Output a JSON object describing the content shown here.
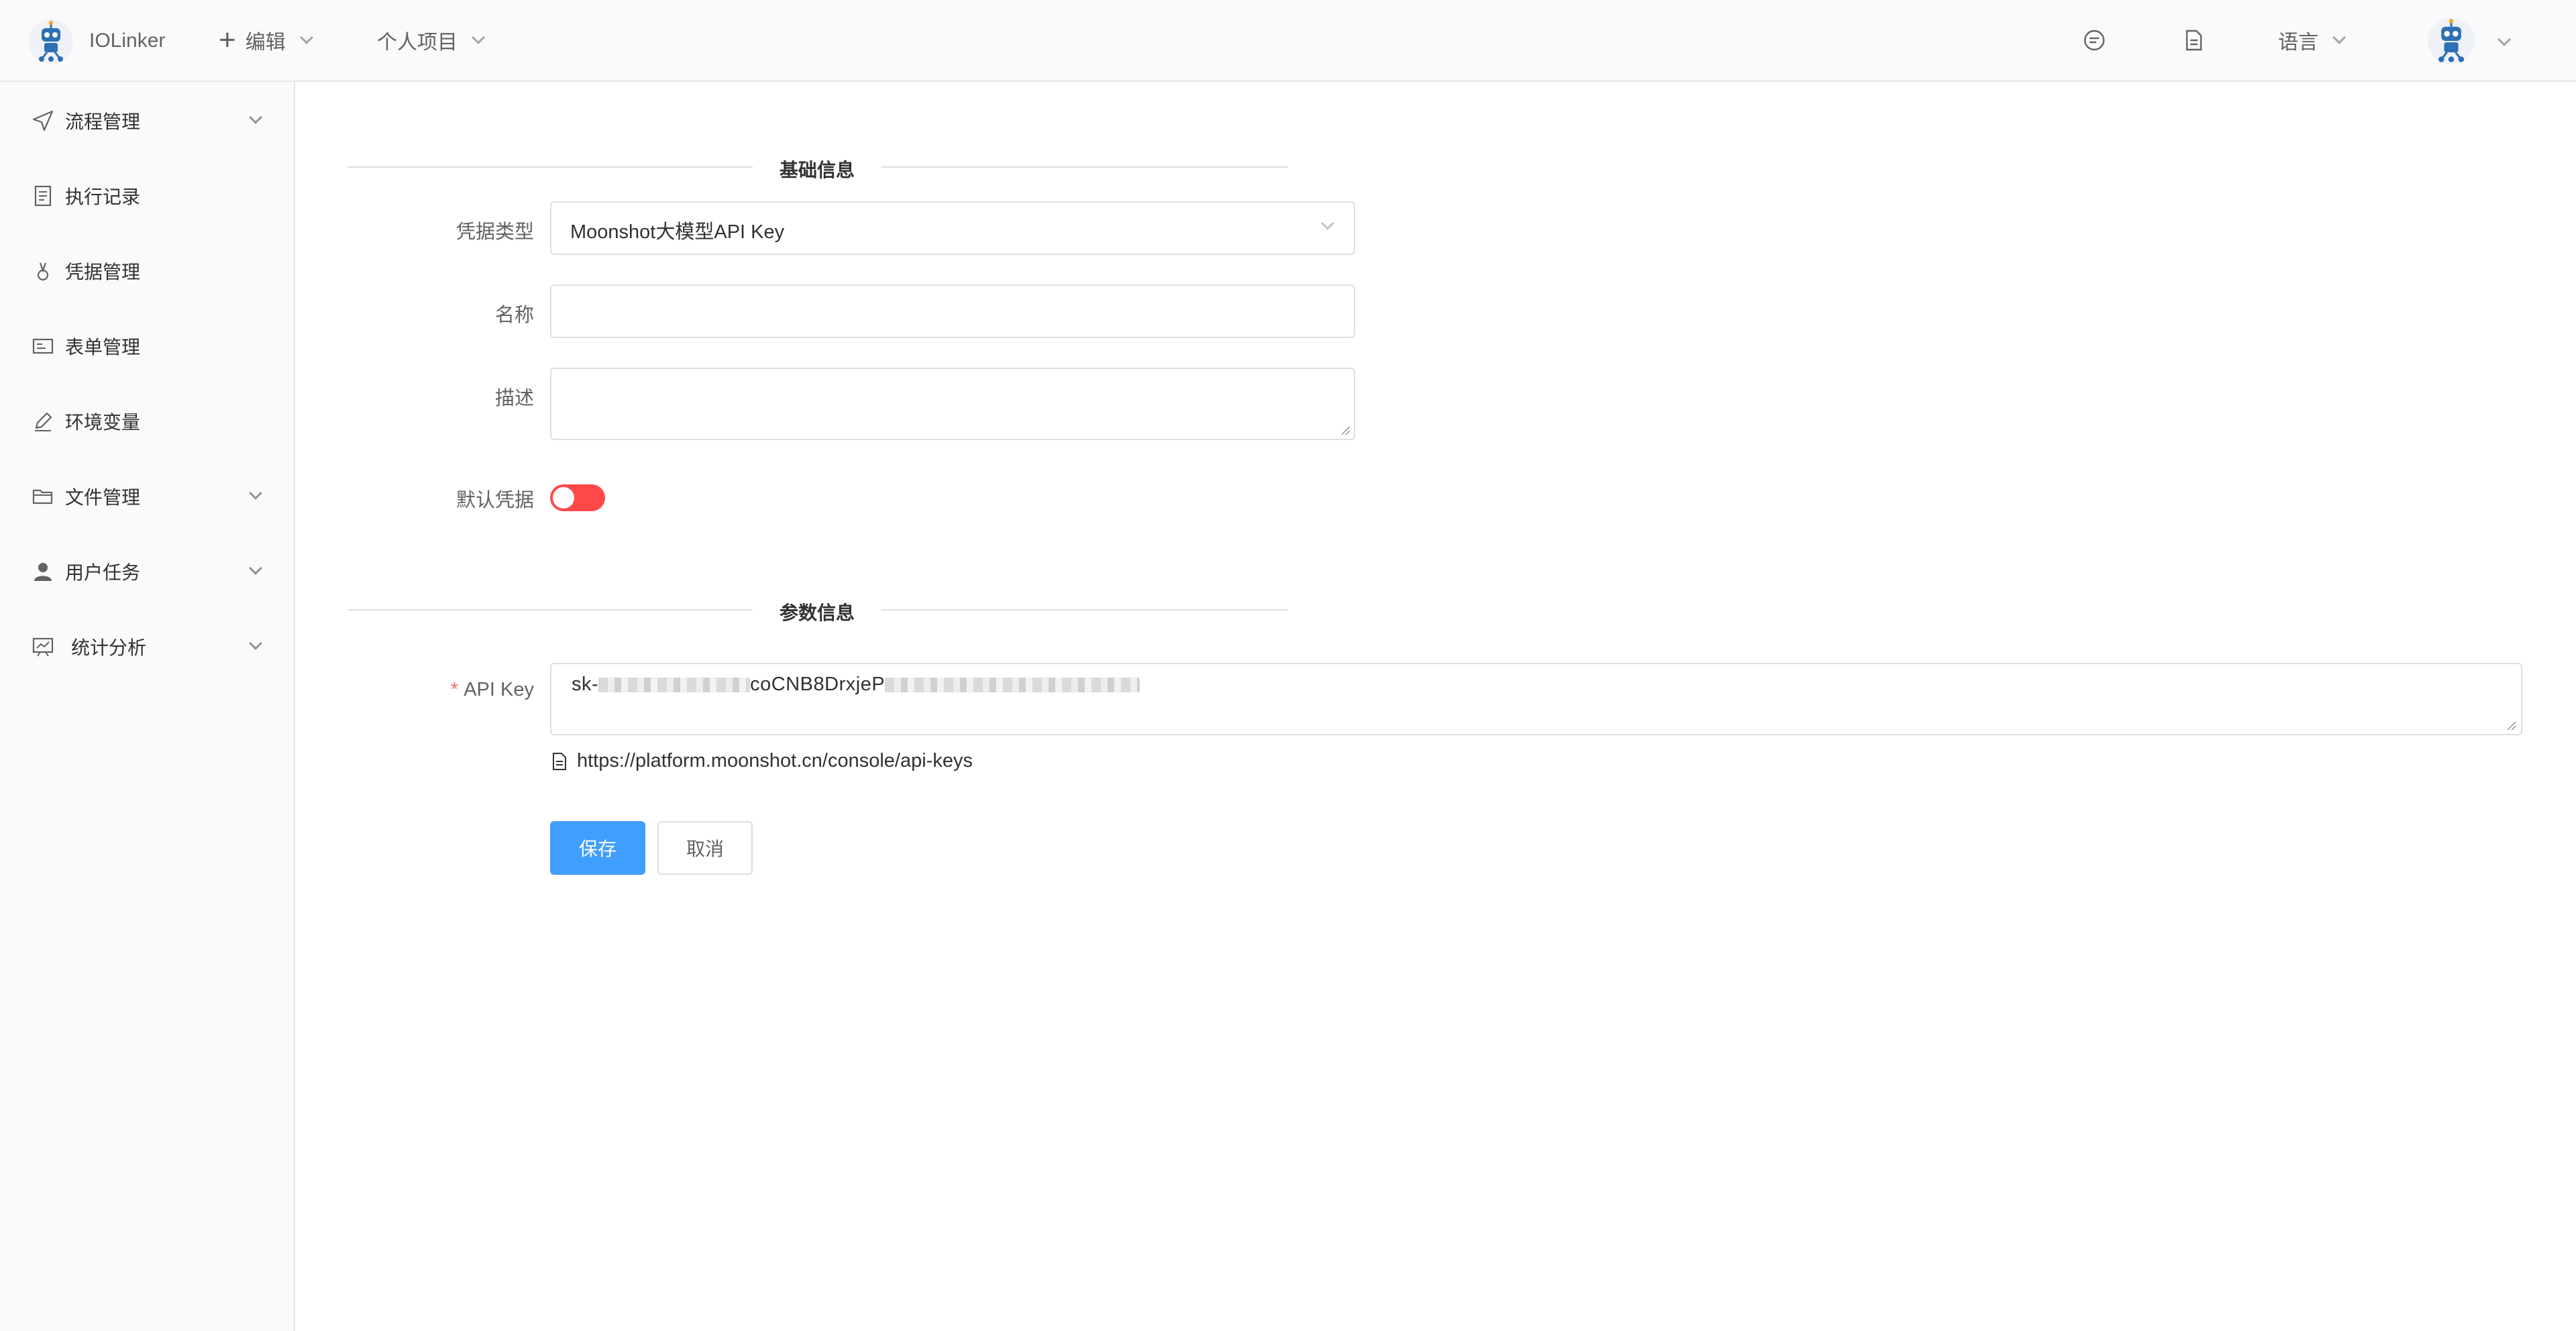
{
  "header": {
    "app_name": "IOLinker",
    "menu": [
      {
        "label": "编辑"
      },
      {
        "label": "个人项目"
      }
    ],
    "language_label": "语言"
  },
  "sidebar": {
    "items": [
      {
        "label": "流程管理",
        "icon": "send-icon",
        "has_children": true
      },
      {
        "label": "执行记录",
        "icon": "document-icon",
        "has_children": false
      },
      {
        "label": "凭据管理",
        "icon": "key-icon",
        "has_children": false
      },
      {
        "label": "表单管理",
        "icon": "form-icon",
        "has_children": false
      },
      {
        "label": "环境变量",
        "icon": "edit-pen-icon",
        "has_children": false
      },
      {
        "label": "文件管理",
        "icon": "folder-icon",
        "has_children": true
      },
      {
        "label": "用户任务",
        "icon": "user-icon",
        "has_children": true
      },
      {
        "label": "统计分析",
        "icon": "chart-board-icon",
        "has_children": true
      }
    ]
  },
  "form": {
    "basic_section_title": "基础信息",
    "credential_type": {
      "label": "凭据类型",
      "value": "Moonshot大模型API Key"
    },
    "name": {
      "label": "名称",
      "value": ""
    },
    "description": {
      "label": "描述",
      "value": ""
    },
    "default_credential": {
      "label": "默认凭据",
      "enabled": false
    },
    "params_section_title": "参数信息",
    "api_key": {
      "label": "API Key",
      "required_mark": "*",
      "value_prefix": "sk-",
      "value_visible_middle": "coCNB8DrxjeP"
    },
    "hint_url": "https://platform.moonshot.cn/console/api-keys",
    "save_label": "保存",
    "cancel_label": "取消"
  },
  "colors": {
    "primary": "#409eff",
    "toggle_off": "#ff4949",
    "required": "#f56c6c"
  }
}
